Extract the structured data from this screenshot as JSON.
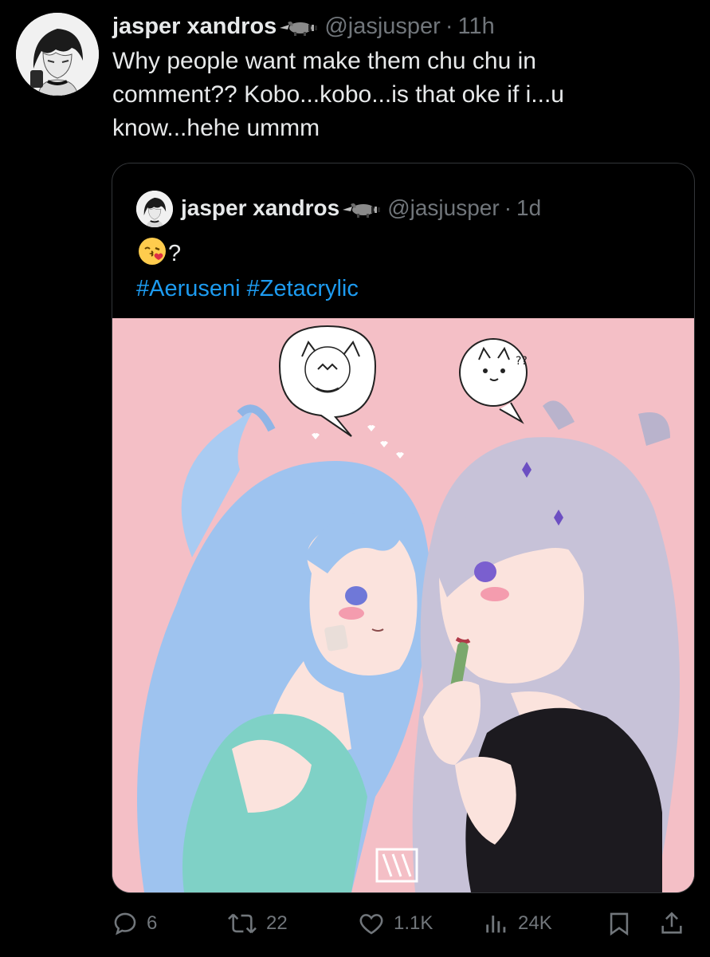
{
  "tweet": {
    "author_name": "jasper xandros",
    "author_handle": "@jasjusper",
    "separator": "·",
    "time": "11h",
    "text": "Why people want make them chu chu in\ncomment?? Kobo...kobo...is that oke if i...u\nknow...hehe ummm",
    "emoji_after_name": "raccoon-icon"
  },
  "quoted": {
    "author_name": "jasper xandros",
    "author_handle": "@jasjusper",
    "separator": "·",
    "time": "1d",
    "text_suffix": "?",
    "emoji": "kissing-face-icon",
    "hashtags": [
      "#Aeruseni",
      "#Zetacrylic"
    ],
    "image_background": "#f4bfc6"
  },
  "actions": {
    "replies": "6",
    "reposts": "22",
    "likes": "1.1K",
    "views": "24K"
  },
  "colors": {
    "background": "#000000",
    "text": "#e7e9ea",
    "secondary": "#71767b",
    "link": "#1d9bf0",
    "border": "#333639"
  }
}
